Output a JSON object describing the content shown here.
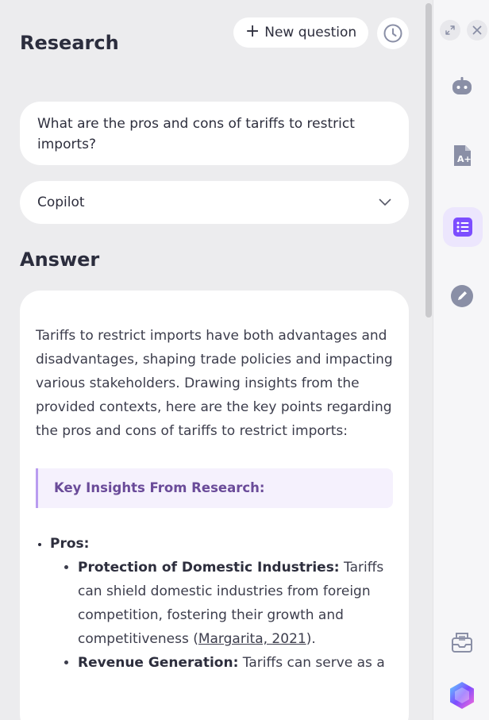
{
  "header": {
    "title": "Research",
    "new_question_label": "New question"
  },
  "question": {
    "text": "What are the pros and cons of tariffs to restrict imports?"
  },
  "model_select": {
    "selected": "Copilot"
  },
  "answer": {
    "heading": "Answer",
    "intro": "Tariffs to restrict imports have both advantages and disadvantages, shaping trade policies and impacting various stakeholders. Drawing insights from the provided contexts, here are the key points regarding the pros and cons of tariffs to restrict imports:",
    "insight_title": "Key Insights From Research:",
    "pros_label": "Pros:",
    "pros": [
      {
        "title": "Protection of Domestic Industries:",
        "text": "Tariffs can shield domestic industries from foreign competition, fostering their growth and competitiveness (",
        "cite": "Margarita, 2021",
        "after": ")."
      },
      {
        "title": "Revenue Generation:",
        "text": "Tariffs can serve as a",
        "cite": "",
        "after": ""
      }
    ]
  },
  "icons": {
    "accent": "#7c4dff",
    "rail_icon_color": "#8a8fa6"
  }
}
